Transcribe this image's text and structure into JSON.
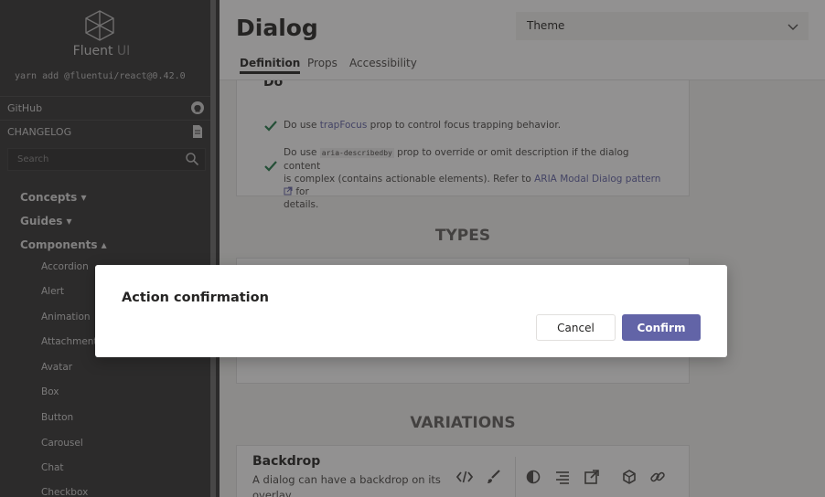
{
  "sidebar": {
    "brand": "Fluent",
    "brand_suffix": "UI",
    "install_cmd": "yarn add @fluentui/react@0.42.0",
    "links": [
      {
        "label": "GitHub",
        "icon": "github-icon"
      },
      {
        "label": "CHANGELOG",
        "icon": "document-icon"
      }
    ],
    "search": {
      "placeholder": "Search"
    },
    "sections": [
      {
        "label": "Concepts ▾"
      },
      {
        "label": "Guides ▾"
      },
      {
        "label": "Components ▴"
      }
    ],
    "components": [
      "Accordion",
      "Alert",
      "Animation",
      "Attachment",
      "Avatar",
      "Box",
      "Button",
      "Carousel",
      "Chat",
      "Checkbox"
    ]
  },
  "header": {
    "title": "Dialog",
    "theme": "Theme",
    "tabs": [
      {
        "label": "Definition",
        "active": true
      },
      {
        "label": "Props",
        "active": false
      },
      {
        "label": "Accessibility",
        "active": false
      }
    ]
  },
  "guidelines": {
    "heading": "Do",
    "item1": {
      "pre": "Do use ",
      "link": "trapFocus",
      "post": " prop to control focus trapping behavior."
    },
    "item2": {
      "pre": "Do use ",
      "code": "aria-describedby",
      "line1_post": " prop to override or omit description if the dialog content",
      "line2_pre": "is complex (contains actionable elements). Refer to ",
      "link": "ARIA Modal Dialog pattern",
      "line2_post": " for",
      "line3": "details."
    }
  },
  "sections": {
    "types": "TYPES",
    "variations": "VARIATIONS"
  },
  "backdrop_example": {
    "title": "Backdrop",
    "description": "A dialog can have a backdrop on its overlay."
  },
  "dialog": {
    "title": "Action confirmation",
    "cancel_label": "Cancel",
    "confirm_label": "Confirm"
  },
  "colors": {
    "brand": "#6264a7",
    "success_check": "#237b4b",
    "overlay": "rgba(37,36,35,0.5)"
  }
}
